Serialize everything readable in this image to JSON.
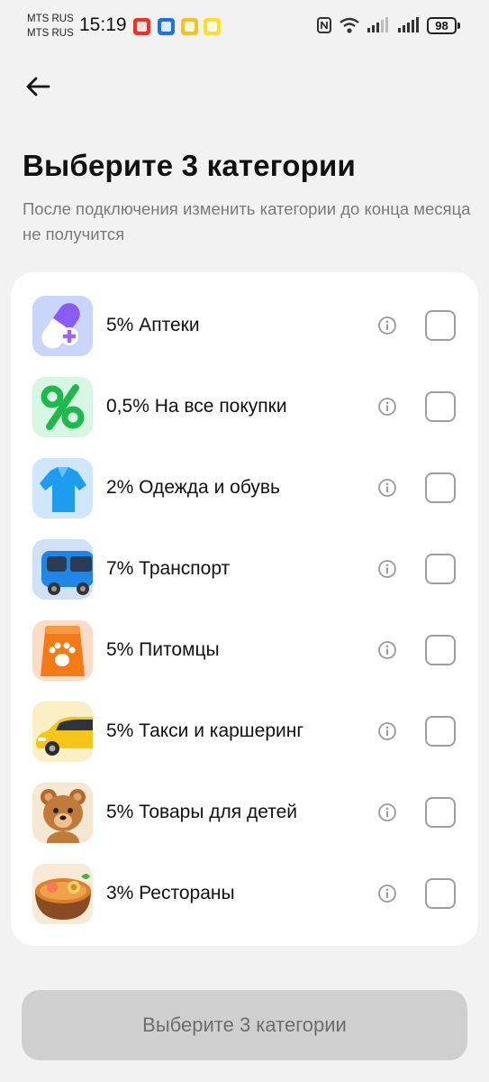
{
  "status_bar": {
    "carrier_1": "MTS RUS",
    "carrier_2": "MTS RUS",
    "time": "15:19",
    "battery": "98",
    "notification_icons": [
      "alfa-bank-icon",
      "bank-app-icon",
      "market-icon",
      "tinkoff-icon"
    ]
  },
  "header": {
    "back_icon": "arrow-left-icon",
    "title": "Выберите 3 категории",
    "subtitle": "После подключения изменить категории до конца месяца не получится"
  },
  "categories": [
    {
      "label": "5% Аптеки",
      "icon": "pill-icon",
      "tile_bg": "#c9d6f9",
      "checked": false
    },
    {
      "label": "0,5% На все покупки",
      "icon": "percent-icon",
      "tile_bg": "#d8f6e4",
      "checked": false
    },
    {
      "label": "2% Одежда и обувь",
      "icon": "shirt-icon",
      "tile_bg": "#cfe6fb",
      "checked": false
    },
    {
      "label": "7% Транспорт",
      "icon": "bus-icon",
      "tile_bg": "#cfe0f7",
      "checked": false
    },
    {
      "label": "5% Питомцы",
      "icon": "pet-food-icon",
      "tile_bg": "#fbdcc9",
      "checked": false
    },
    {
      "label": "5% Такси и каршеринг",
      "icon": "taxi-car-icon",
      "tile_bg": "#faefc5",
      "checked": false
    },
    {
      "label": "5% Товары для детей",
      "icon": "teddy-bear-icon",
      "tile_bg": "#f6e7d2",
      "checked": false
    },
    {
      "label": "3% Рестораны",
      "icon": "food-bowl-icon",
      "tile_bg": "#f8ead6",
      "checked": false
    }
  ],
  "submit_button": {
    "label": "Выберите 3 категории",
    "enabled": false
  },
  "colors": {
    "background": "#f2f2f2",
    "card": "#ffffff",
    "button_disabled": "#cfcfcf"
  }
}
